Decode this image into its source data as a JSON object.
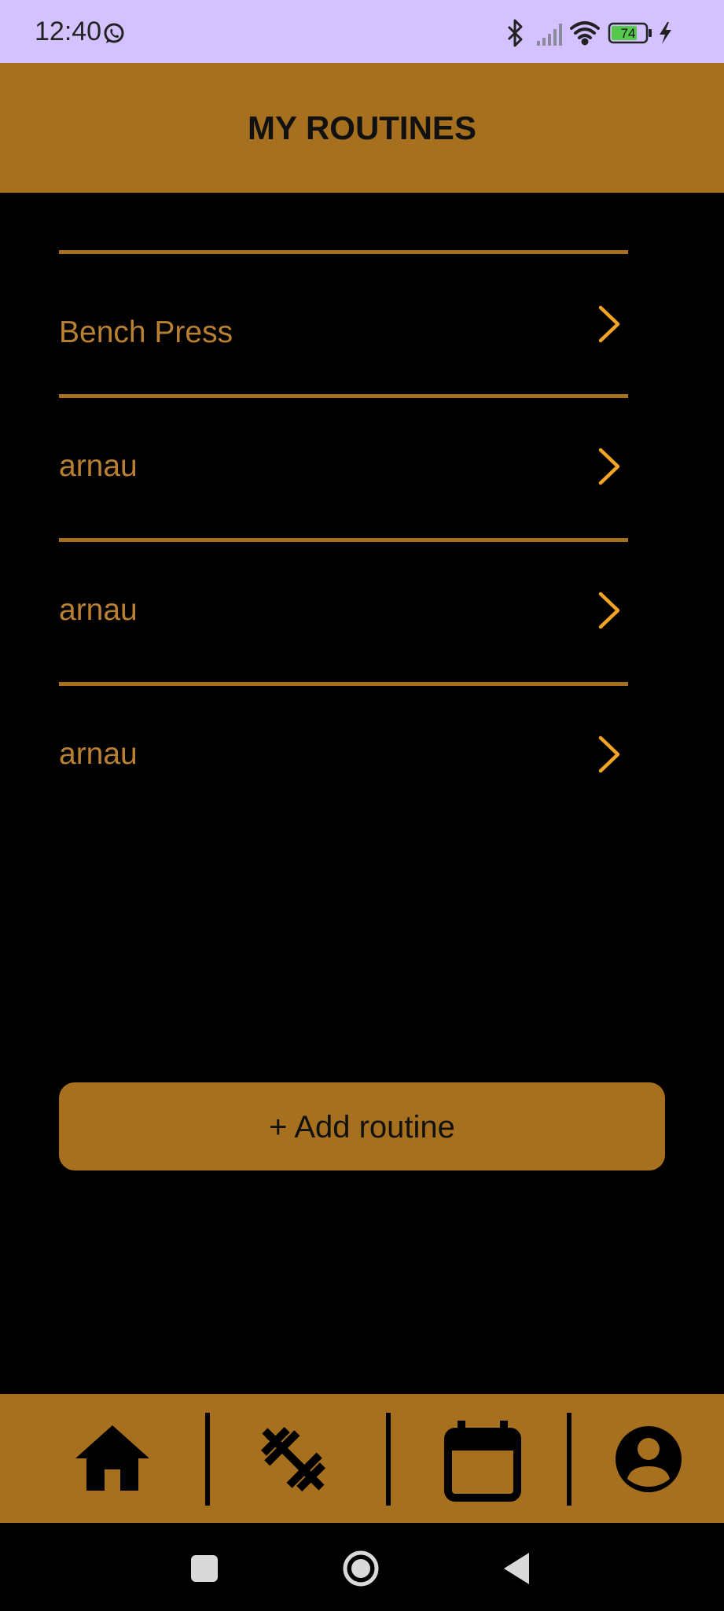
{
  "status_bar": {
    "time": "12:40",
    "battery_level": "74",
    "icons": [
      "whatsapp-icon",
      "bluetooth-icon",
      "signal-icon",
      "wifi-icon",
      "battery-icon",
      "charging-icon"
    ]
  },
  "header": {
    "title": "MY ROUTINES"
  },
  "routines": [
    {
      "label": "Bench Press"
    },
    {
      "label": "arnau"
    },
    {
      "label": "arnau"
    },
    {
      "label": "arnau"
    }
  ],
  "add_button": {
    "label": "+ Add routine"
  },
  "bottom_nav": {
    "items": [
      "home-icon",
      "dumbbell-icon",
      "calendar-icon",
      "profile-icon"
    ]
  },
  "system_nav": {
    "items": [
      "recents-icon",
      "home-circle-icon",
      "back-icon"
    ]
  },
  "colors": {
    "status_bar_bg": "#d3c2ff",
    "accent": "#a6701e",
    "routine_text": "#b98032",
    "chevron": "#f3a423",
    "background": "#000000"
  }
}
